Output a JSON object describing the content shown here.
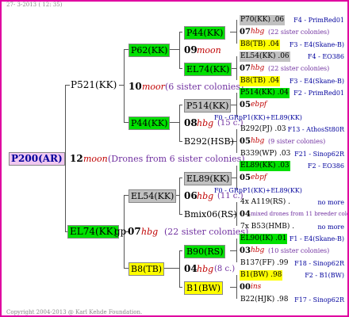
{
  "header_date": "27-  3-2013 ( 12: 35)",
  "footer": "Copyright 2004-2013 @ Karl Kehde Foundation.",
  "root": {
    "label": "P200(AR)",
    "color": "#f0c8f0"
  },
  "gen1": [
    {
      "id": "P521(KK)"
    },
    {
      "id": "EL74(KK)",
      "suffix": "gp"
    }
  ],
  "gen1_info": [
    {
      "num": "12",
      "race": "moon",
      "text": "(Drones from 6 sister colonies)"
    },
    {
      "num": "07",
      "race": "hbg",
      "text": "(22 sister colonies)"
    }
  ],
  "gen2": [
    {
      "id": "P62(KK)"
    },
    {
      "id": "P44(KK)"
    },
    {
      "id": "EL54(KK)"
    },
    {
      "id": "B8(TB)"
    }
  ],
  "gen2_info": [
    {
      "num": "10",
      "race": "moor",
      "text": "(6 sister colonies)"
    },
    {
      "num": "06",
      "race": "hbg",
      "text": "(11 c.)"
    },
    {
      "num": "04",
      "race": "hbg",
      "text": "(8 c.)"
    }
  ],
  "gen3": [
    {
      "id": "P44(KK)"
    },
    {
      "id": "EL74(KK)"
    },
    {
      "id": "P514(KK)"
    },
    {
      "id": "B292(HSB)"
    },
    {
      "id": "EL89(KK)"
    },
    {
      "id": "Bmix06(RS)"
    },
    {
      "id": "B90(RS)"
    },
    {
      "id": "B1(BW)"
    }
  ],
  "gen3_info": [
    {
      "num": "09",
      "race": "moon",
      "text": ""
    },
    {
      "num": "08",
      "race": "hbg",
      "text": "(15 c.)"
    }
  ],
  "gen4": [
    {
      "id": "P70(KK)",
      "val": ".06",
      "right": "F4 - PrimRed01"
    },
    {
      "num": "07",
      "race": "hbg",
      "text": "(22 sister colonies)"
    },
    {
      "id": "B8(TB)",
      "val": ".04",
      "right": "F3 - E4(Skane-B)"
    },
    {
      "id": "EL54(KK)",
      "val": ".06",
      "right": "F4 - EO386"
    },
    {
      "num": "07",
      "race": "hbg",
      "text": "(22 sister colonies)"
    },
    {
      "id": "B8(TB)",
      "val": ".04",
      "right": "F3 - E4(Skane-B)"
    },
    {
      "id": "P514(KK)",
      "val": ".04",
      "right": "F2 - PrimRed01"
    },
    {
      "num": "05",
      "race": "ebpf",
      "text": ""
    },
    {
      "text": "F0 - GRpP1(KK)+EL89(KK)"
    },
    {
      "id": "B292(PJ)",
      "val": ".03",
      "right": "F13 - AthosSt80R"
    },
    {
      "num": "05",
      "race": "hbg",
      "text": "(9 sister colonies)"
    },
    {
      "id": "B339(WP)",
      "val": ".03",
      "right": "F21 - Sinop62R"
    },
    {
      "id": "EL89(KK)",
      "val": ".03",
      "right": "F2 - EO386"
    },
    {
      "num": "05",
      "race": "ebpf",
      "text": ""
    },
    {
      "text": "F0 - GRpP1(KK)+EL89(KK)"
    },
    {
      "id": "4x A119(RS)",
      "val": ".",
      "right": "no more"
    },
    {
      "num": "04",
      "text": "mixed drones from 11 breeder colonies"
    },
    {
      "id": "7x B53(HMB)",
      "val": ".",
      "right": "no more"
    },
    {
      "id": "EL90(IK)",
      "val": ".01",
      "right": "F1 - E4(Skane-B)"
    },
    {
      "num": "03",
      "race": "hbg",
      "text": "(10 sister colonies)"
    },
    {
      "id": "B137(FF)",
      "val": ".99",
      "right": "F18 - Sinop62R"
    },
    {
      "id": "B1(BW)",
      "val": ".98",
      "right": "F2 - B1(BW)"
    },
    {
      "num": "00",
      "race": "ins",
      "text": ""
    },
    {
      "id": "B22(HJK)",
      "val": ".98",
      "right": "F17 - Sinop62R"
    }
  ],
  "colors": {
    "green": "#00e000",
    "yellow": "#ffff00",
    "gray": "#c0c0c0",
    "pink": "#f0c8f0",
    "border": "#e000a0"
  }
}
